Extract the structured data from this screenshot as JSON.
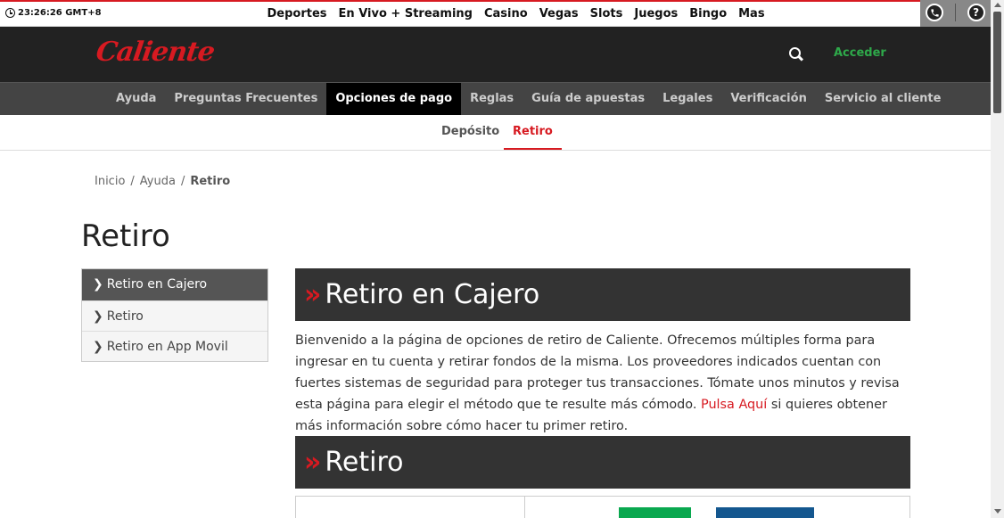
{
  "topbar": {
    "clock": "23:26:26 GMT+8",
    "nav": [
      "Deportes",
      "En Vivo + Streaming",
      "Casino",
      "Vegas",
      "Slots",
      "Juegos",
      "Bingo",
      "Mas"
    ],
    "help_glyph": "?"
  },
  "header": {
    "logo_text": "Caliente",
    "login_label": "Acceder"
  },
  "nav2": [
    "Ayuda",
    "Preguntas Frecuentes",
    "Opciones de pago",
    "Reglas",
    "Guía de apuestas",
    "Legales",
    "Verificación",
    "Servicio al cliente"
  ],
  "subtabs": [
    "Depósito",
    "Retiro"
  ],
  "breadcrumb": [
    "Inicio",
    "Ayuda",
    "Retiro"
  ],
  "breadcrumb_sep": "/",
  "page_title": "Retiro",
  "sidemenu": [
    "Retiro en Cajero",
    "Retiro",
    "Retiro en App Movil"
  ],
  "sections": {
    "first": "Retiro en Cajero",
    "second": "Retiro",
    "marker": "»"
  },
  "intro": {
    "before_link": "Bienvenido a la página de opciones de retiro de Caliente. Ofrecemos múltiples forma para ingresar en tu cuenta y retirar fondos de la misma. Los proveedores indicados cuentan con fuertes sistemas de seguridad para proteger tus transacciones. Tómate unos minutos y revisa esta página para elegir el método que te resulte más cómodo. ",
    "link": "Pulsa Aquí",
    "after_link": " si quieres obtener más información sobre cómo hacer tu primer retiro."
  },
  "colors": {
    "brand_red": "#d71a21",
    "header_bg": "#222222",
    "nav_bg": "#444444",
    "login_green": "#2ea94a"
  }
}
